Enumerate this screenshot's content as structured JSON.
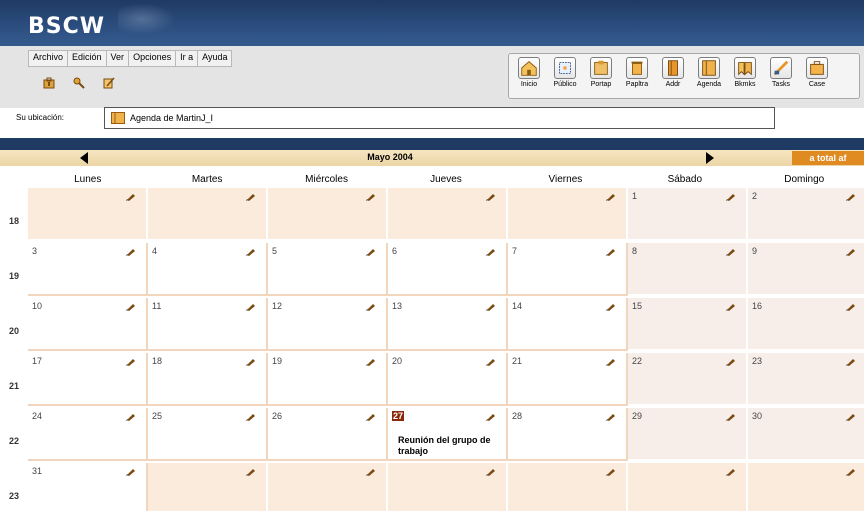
{
  "app": {
    "logo": "BSCW"
  },
  "menu": [
    "Archivo",
    "Edición",
    "Ver",
    "Opciones",
    "Ir a",
    "Ayuda"
  ],
  "action_icons": [
    "bag-icon",
    "key-icon",
    "edit-note-icon"
  ],
  "toolbar": [
    {
      "label": "Inicio",
      "icon": "home-icon"
    },
    {
      "label": "Público",
      "icon": "public-icon"
    },
    {
      "label": "Portap",
      "icon": "clipboard-icon"
    },
    {
      "label": "Papltra",
      "icon": "trash-icon"
    },
    {
      "label": "Addr",
      "icon": "addressbook-icon"
    },
    {
      "label": "Agenda",
      "icon": "agenda-icon"
    },
    {
      "label": "Bkmks",
      "icon": "bookmarks-icon"
    },
    {
      "label": "Tasks",
      "icon": "tasks-icon"
    },
    {
      "label": "Case",
      "icon": "case-icon"
    }
  ],
  "location": {
    "label": "Su ubicación:",
    "value": "Agenda de MartinJ_I"
  },
  "calendar": {
    "month": "Mayo 2004",
    "total_button": "a total af",
    "days": [
      "Lunes",
      "Martes",
      "Miércoles",
      "Jueves",
      "Viernes",
      "Sábado",
      "Domingo"
    ],
    "weeks": [
      {
        "number": "18",
        "days": [
          "",
          "",
          "",
          "",
          "",
          "1",
          "2"
        ]
      },
      {
        "number": "19",
        "days": [
          "3",
          "4",
          "5",
          "6",
          "7",
          "8",
          "9"
        ]
      },
      {
        "number": "20",
        "days": [
          "10",
          "11",
          "12",
          "13",
          "14",
          "15",
          "16"
        ]
      },
      {
        "number": "21",
        "days": [
          "17",
          "18",
          "19",
          "20",
          "21",
          "22",
          "23"
        ]
      },
      {
        "number": "22",
        "days": [
          "24",
          "25",
          "26",
          "27",
          "28",
          "29",
          "30"
        ]
      },
      {
        "number": "23",
        "days": [
          "31",
          "",
          "",
          "",
          "",
          "",
          ""
        ]
      }
    ],
    "today": "27",
    "events": [
      {
        "day": "27",
        "title": "Reunión del grupo de trabajo"
      }
    ]
  },
  "colors": {
    "header": "#1f3a63",
    "month_bar": "#f7e6c2",
    "total_button": "#e08b21",
    "cell_in_month": "#ffffff",
    "cell_out_month": "#fbebdd",
    "cell_weekend": "#f7eeea",
    "today_marker": "#8a2a0a"
  }
}
